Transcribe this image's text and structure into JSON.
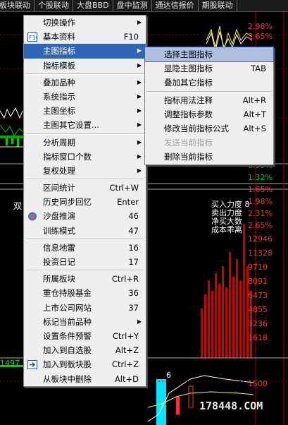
{
  "tabs": [
    "板块联动",
    "个股联动",
    "大盘BBD",
    "盘中监测",
    "通达信报价",
    "期股联动"
  ],
  "menu": [
    {
      "label": "切换操作",
      "arrow": true
    },
    {
      "label": "基本资料",
      "shortcut": "F10",
      "icon": "f10-icon"
    },
    {
      "label": "主图指标",
      "arrow": true,
      "selected": true
    },
    {
      "label": "指标模板",
      "arrow": true
    },
    {
      "sep": true
    },
    {
      "label": "叠加品种",
      "arrow": true
    },
    {
      "label": "系统指示",
      "arrow": true
    },
    {
      "label": "主图坐标",
      "arrow": true
    },
    {
      "label": "主图其它设置...",
      "arrow": true
    },
    {
      "sep": true
    },
    {
      "label": "分析周期",
      "arrow": true
    },
    {
      "label": "指标窗口个数",
      "arrow": true
    },
    {
      "label": "复权处理",
      "arrow": true
    },
    {
      "sep": true
    },
    {
      "label": "区间统计",
      "shortcut": "Ctrl+W"
    },
    {
      "label": "历史同步回忆",
      "shortcut": "Enter"
    },
    {
      "label": "沙盘推演",
      "shortcut": "46",
      "icon": "sandbox-icon"
    },
    {
      "label": "训练模式",
      "shortcut": "47"
    },
    {
      "sep": true
    },
    {
      "label": "信息地雷",
      "shortcut": "16"
    },
    {
      "label": "投资日记",
      "shortcut": "17"
    },
    {
      "sep": true
    },
    {
      "label": "所属板块",
      "shortcut": "Ctrl+R"
    },
    {
      "label": "重仓持股基金",
      "shortcut": "36"
    },
    {
      "label": "上市公司网站",
      "shortcut": "37"
    },
    {
      "label": "标记当前品种",
      "arrow": true
    },
    {
      "label": "设置条件预警",
      "shortcut": "Ctrl+Y"
    },
    {
      "label": "加入到自选股",
      "shortcut": "Alt+Z"
    },
    {
      "label": "加入到板块股",
      "shortcut": "Ctrl+Z",
      "icon": "add-to-block-icon"
    },
    {
      "label": "从板块中删除",
      "shortcut": "Alt+D"
    }
  ],
  "submenu": [
    {
      "label": "选择主图指标",
      "highlighted": true
    },
    {
      "label": "显隐主图指标",
      "shortcut": "TAB"
    },
    {
      "label": "叠加其它指标"
    },
    {
      "sep": true
    },
    {
      "label": "指标用法注释",
      "shortcut": "Alt+R"
    },
    {
      "label": "调整指标参数",
      "shortcut": "Alt+T"
    },
    {
      "label": "修改当前指标公式",
      "shortcut": "Alt+S"
    },
    {
      "label": "发送当前指标",
      "disabled": true
    },
    {
      "label": "删除当前指标"
    }
  ],
  "right_values": [
    {
      "text": "2.98%",
      "color": "#ff3333"
    },
    {
      "text": "2.65%",
      "color": "#ff3333"
    },
    {
      "text": "0.99%",
      "color": "#00cc00"
    },
    {
      "text": "1.32%",
      "color": "#00cc00"
    },
    {
      "text": "1.65%",
      "color": "#ff3333"
    },
    {
      "text": "1.98%",
      "color": "#ff3333"
    },
    {
      "text": "2.31%",
      "color": "#ff3333"
    },
    {
      "text": "2.65%",
      "color": "#ff3333"
    },
    {
      "text": "12946",
      "color": "#ff3333"
    },
    {
      "text": "11328",
      "color": "#ff3333"
    },
    {
      "text": "9710",
      "color": "#ff3333"
    },
    {
      "text": "8091",
      "color": "#ff3333"
    },
    {
      "text": "6473",
      "color": "#ff3333"
    },
    {
      "text": "4855",
      "color": "#ff3333"
    },
    {
      "text": "3236",
      "color": "#ff3333"
    },
    {
      "text": "1618",
      "color": "#ff3333"
    },
    {
      "text": "1500",
      "color": "#ff3333"
    }
  ],
  "side_labels": [
    "买入力度 8",
    "卖出力度",
    "净买大数",
    "成本乖离"
  ],
  "left_labels": {
    "shuang": "双",
    "vol": "1497",
    "cyan_num": "6"
  },
  "watermark": "178448.COM"
}
